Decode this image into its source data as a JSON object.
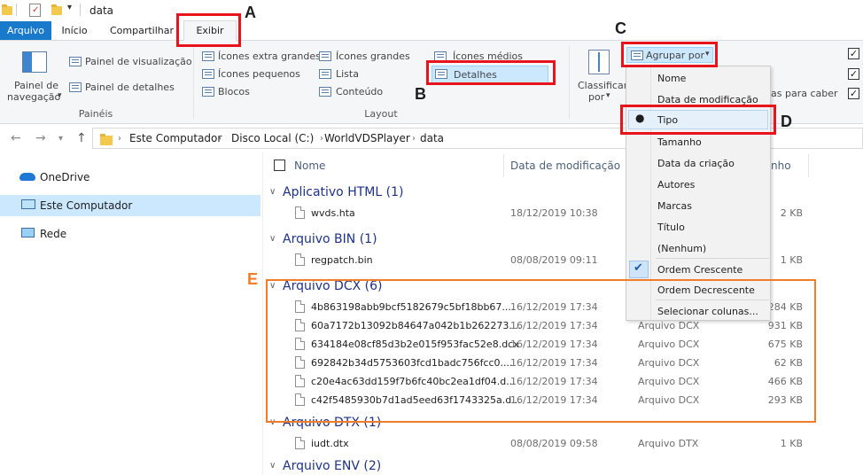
{
  "window": {
    "title": "data"
  },
  "tabs": {
    "arquivo": "Arquivo",
    "inicio": "Início",
    "compartilhar": "Compartilhar",
    "exibir": "Exibir"
  },
  "ribbon": {
    "panes": {
      "navigation_line1": "Painel de",
      "navigation_line2": "navegação",
      "preview": "Painel de visualização",
      "details": "Painel de detalhes",
      "group_label": "Painéis"
    },
    "layout": {
      "items": [
        "Ícones extra grandes",
        "Ícones grandes",
        "Ícones médios",
        "Ícones pequenos",
        "Lista",
        "Detalhes",
        "Blocos",
        "Conteúdo"
      ],
      "group_label": "Layout"
    },
    "current_view": {
      "sort_line1": "Classificar",
      "sort_line2": "por",
      "group_by": "Agrupar por",
      "fit_columns": "as para caber"
    }
  },
  "address": {
    "crumbs": [
      "Este Computador",
      "Disco Local (C:)",
      "WorldVDSPlayer",
      "data"
    ]
  },
  "nav": {
    "items": [
      "OneDrive",
      "Este Computador",
      "Rede"
    ]
  },
  "columns": {
    "name": "Nome",
    "date": "Data de modificação",
    "size_partial": "nho"
  },
  "groups": [
    {
      "title": "Aplicativo HTML (1)",
      "files": [
        {
          "name": "wvds.hta",
          "date": "18/12/2019 10:38",
          "type": "",
          "size": "2 KB"
        }
      ]
    },
    {
      "title": "Arquivo BIN (1)",
      "files": [
        {
          "name": "regpatch.bin",
          "date": "08/08/2019 09:11",
          "type": "",
          "size": "1 KB"
        }
      ]
    },
    {
      "title": "Arquivo DCX (6)",
      "files": [
        {
          "name": "4b863198abb9bcf5182679c5bf18bb67....",
          "date": "16/12/2019 17:34",
          "type": "",
          "size": "284 KB"
        },
        {
          "name": "60a7172b13092b84647a042b1b262273....",
          "date": "16/12/2019 17:34",
          "type": "Arquivo DCX",
          "size": "931 KB"
        },
        {
          "name": "634184e08cf85d3b2e015f953fac52e8.dcx",
          "date": "16/12/2019 17:34",
          "type": "Arquivo DCX",
          "size": "675 KB"
        },
        {
          "name": "692842b34d5753603fcd1badc756fcc0....",
          "date": "16/12/2019 17:34",
          "type": "Arquivo DCX",
          "size": "62 KB"
        },
        {
          "name": "c20e4ac63dd159f7b6fc40bc2ea1df04.d...",
          "date": "16/12/2019 17:34",
          "type": "Arquivo DCX",
          "size": "466 KB"
        },
        {
          "name": "c42f5485930b7d1ad5eed63f1743325a.d...",
          "date": "16/12/2019 17:34",
          "type": "Arquivo DCX",
          "size": "293 KB"
        }
      ]
    },
    {
      "title": "Arquivo DTX (1)",
      "files": [
        {
          "name": "iudt.dtx",
          "date": "08/08/2019 09:58",
          "type": "Arquivo DTX",
          "size": "1 KB"
        }
      ]
    },
    {
      "title": "Arquivo ENV (2)",
      "files": []
    }
  ],
  "menu": {
    "items": [
      "Nome",
      "Data de modificação",
      "Tipo",
      "Tamanho",
      "Data da criação",
      "Autores",
      "Marcas",
      "Título",
      "(Nenhum)"
    ],
    "order": [
      "Ordem Crescente",
      "Ordem Decrescente"
    ],
    "choose_columns": "Selecionar colunas..."
  },
  "annotations": {
    "a": "A",
    "b": "B",
    "c": "C",
    "d": "D",
    "e": "E"
  },
  "colors": {
    "red": "#e8131b",
    "orange": "#f07d2a",
    "accent": "#1979ca"
  }
}
